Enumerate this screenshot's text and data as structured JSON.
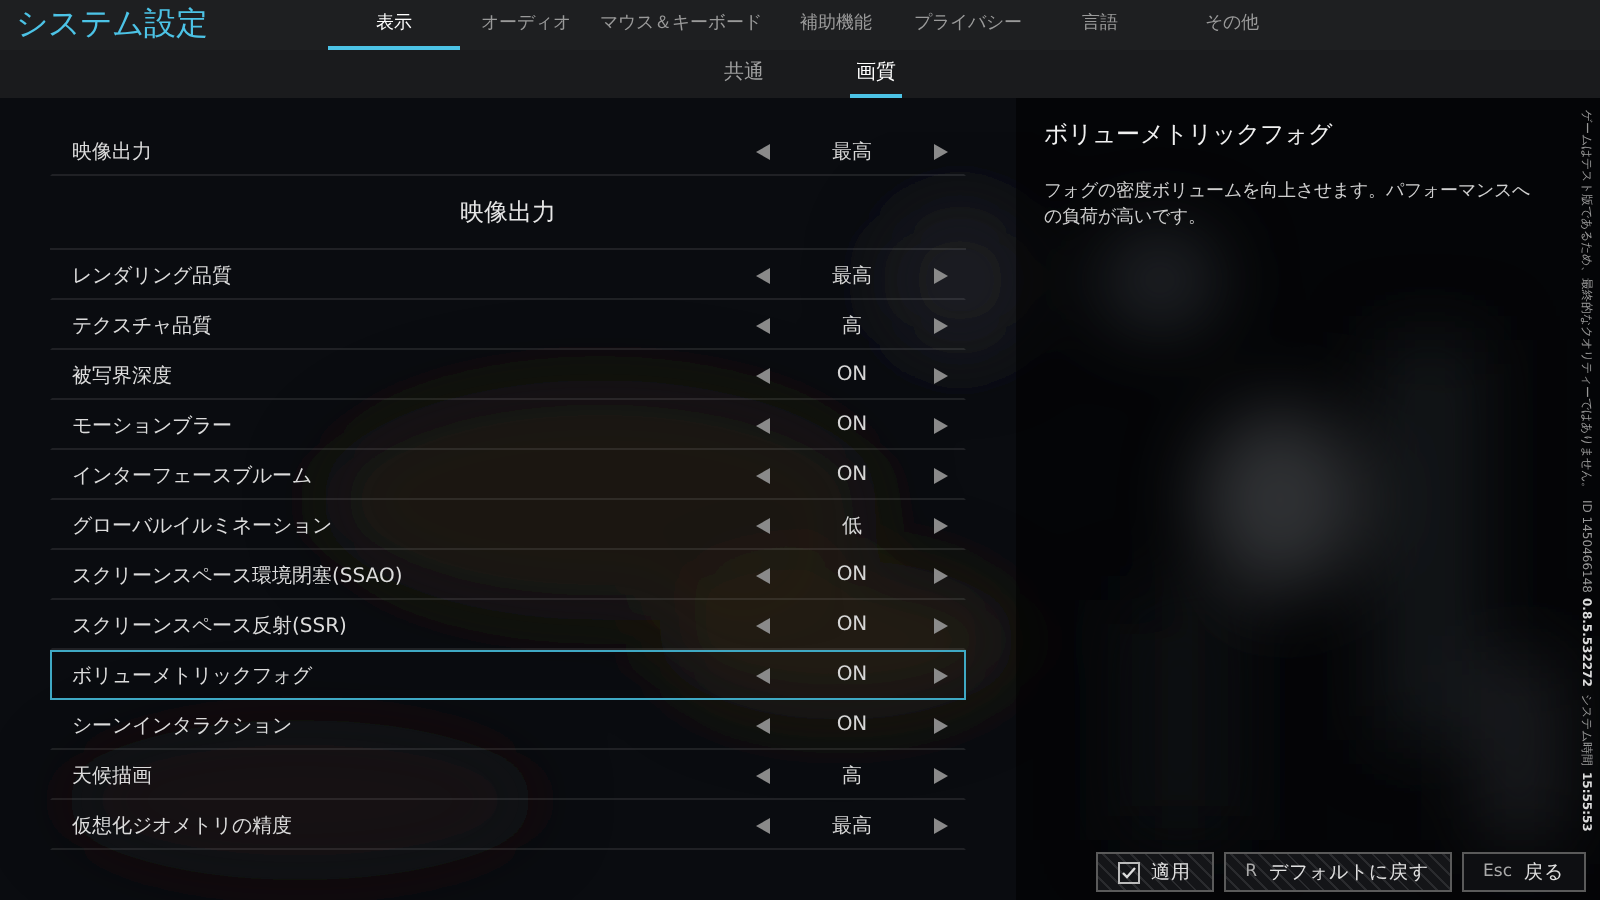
{
  "title": "システム設定",
  "tabs": [
    {
      "label": "表示",
      "selected": true
    },
    {
      "label": "オーディオ",
      "selected": false
    },
    {
      "label": "マウス＆キーボード",
      "selected": false
    },
    {
      "label": "補助機能",
      "selected": false
    },
    {
      "label": "プライバシー",
      "selected": false
    },
    {
      "label": "言語",
      "selected": false
    },
    {
      "label": "その他",
      "selected": false
    }
  ],
  "subtabs": [
    {
      "label": "共通",
      "selected": false
    },
    {
      "label": "画質",
      "selected": true
    }
  ],
  "settings": [
    {
      "kind": "option",
      "label": "映像出力",
      "value": "最高",
      "selected": false
    },
    {
      "kind": "heading",
      "label": "映像出力"
    },
    {
      "kind": "option",
      "label": "レンダリング品質",
      "value": "最高",
      "selected": false
    },
    {
      "kind": "option",
      "label": "テクスチャ品質",
      "value": "高",
      "selected": false
    },
    {
      "kind": "option",
      "label": "被写界深度",
      "value": "ON",
      "selected": false
    },
    {
      "kind": "option",
      "label": "モーションブラー",
      "value": "ON",
      "selected": false
    },
    {
      "kind": "option",
      "label": "インターフェースブルーム",
      "value": "ON",
      "selected": false
    },
    {
      "kind": "option",
      "label": "グローバルイルミネーション",
      "value": "低",
      "selected": false
    },
    {
      "kind": "option",
      "label": "スクリーンスペース環境閉塞(SSAO)",
      "value": "ON",
      "selected": false
    },
    {
      "kind": "option",
      "label": "スクリーンスペース反射(SSR)",
      "value": "ON",
      "selected": false
    },
    {
      "kind": "option",
      "label": "ボリューメトリックフォグ",
      "value": "ON",
      "selected": true
    },
    {
      "kind": "option",
      "label": "シーンインタラクション",
      "value": "ON",
      "selected": false
    },
    {
      "kind": "option",
      "label": "天候描画",
      "value": "高",
      "selected": false
    },
    {
      "kind": "option",
      "label": "仮想化ジオメトリの精度",
      "value": "最高",
      "selected": false
    }
  ],
  "detail": {
    "title": "ボリューメトリックフォグ",
    "description": "フォグの密度ボリュームを向上させます。パフォーマンスへの負荷が高いです。"
  },
  "side_info": [
    "ゲームはテスト版であるため、最終的なクオリティーではありません。",
    "ID 1450466148",
    "0.8.5.532272",
    "システム時間",
    "15:55:53"
  ],
  "actions": [
    {
      "kind": "confirm",
      "label": "適用"
    },
    {
      "kind": "reset",
      "key": "R",
      "label": "デフォルトに戻す"
    },
    {
      "kind": "back",
      "key": "Esc",
      "label": "戻る"
    }
  ]
}
